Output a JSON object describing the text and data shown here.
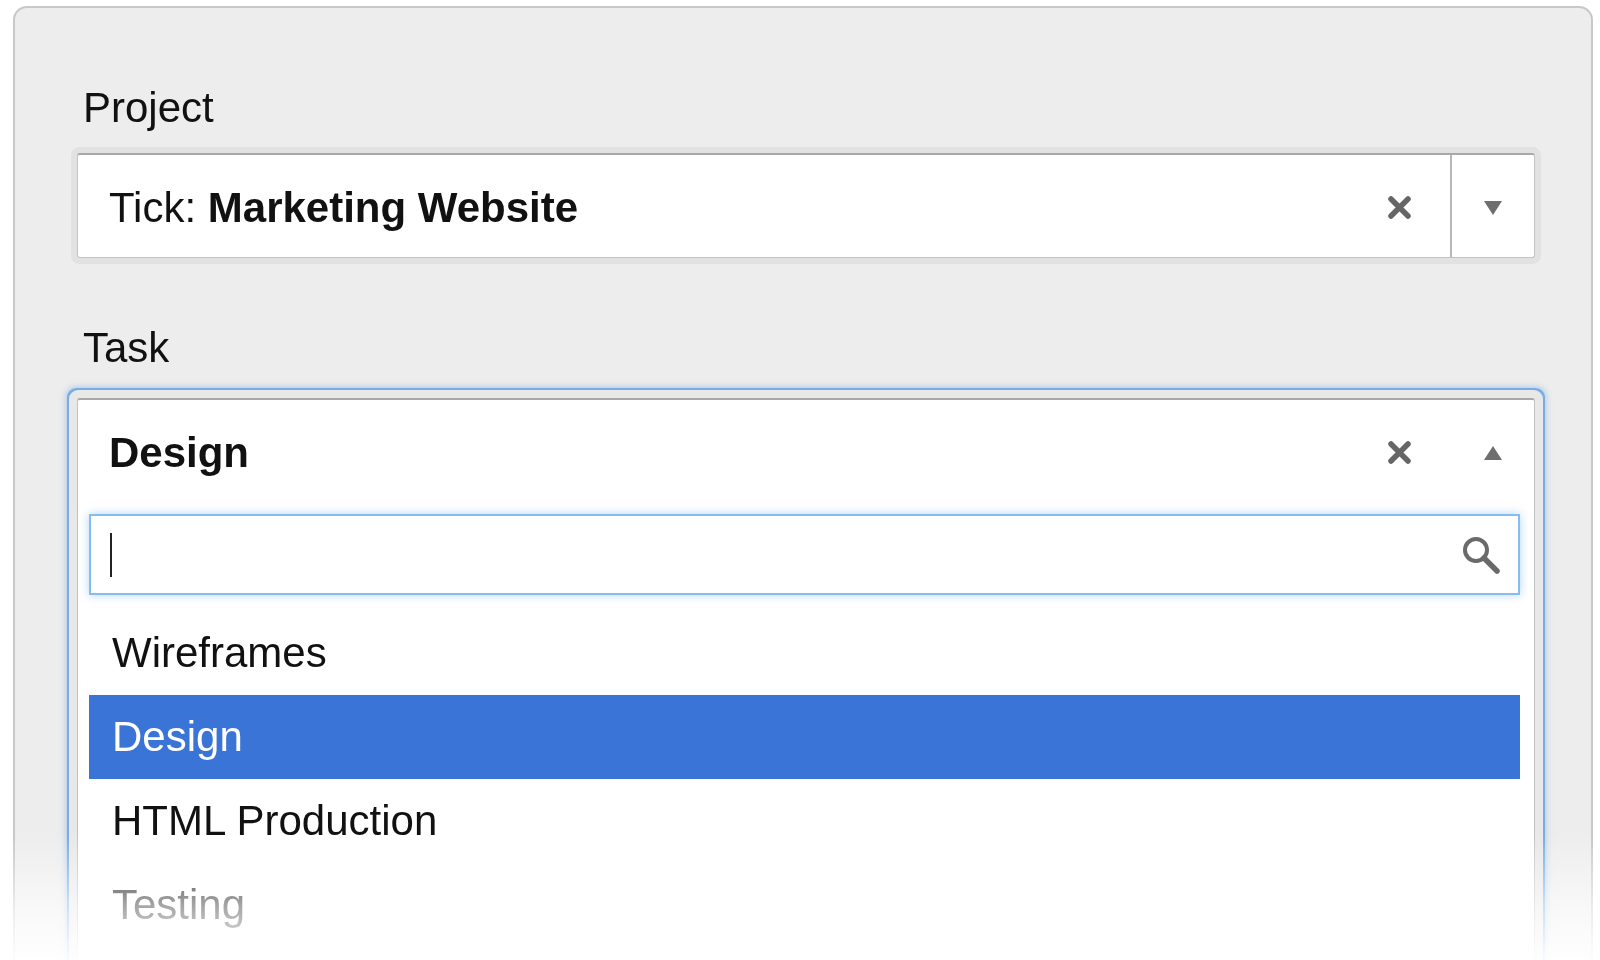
{
  "fields": [
    {
      "label": "Project",
      "prefix": "Tick:",
      "value": "Marketing Website",
      "expanded": false
    },
    {
      "label": "Task",
      "value": "Design",
      "expanded": true,
      "options": [
        {
          "label": "Wireframes",
          "selected": false
        },
        {
          "label": "Design",
          "selected": true
        },
        {
          "label": "HTML Production",
          "selected": false
        },
        {
          "label": "Testing",
          "selected": false
        }
      ]
    }
  ]
}
